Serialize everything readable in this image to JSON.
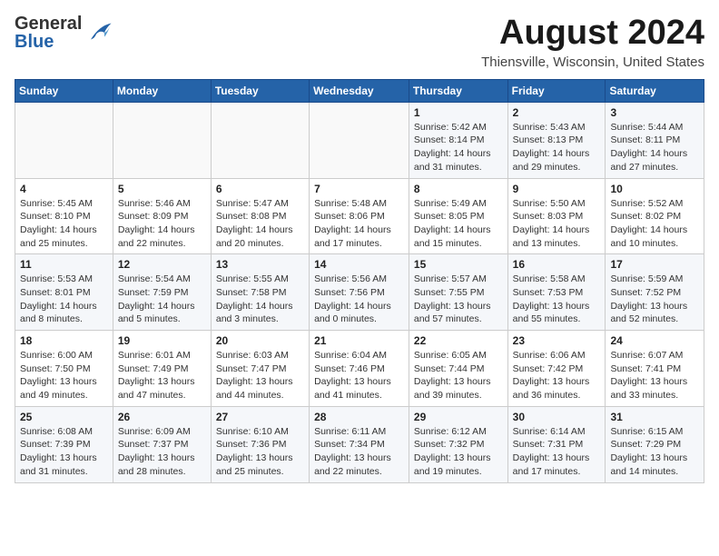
{
  "header": {
    "logo": {
      "line1": "General",
      "line2": "Blue"
    },
    "month_title": "August 2024",
    "location": "Thiensville, Wisconsin, United States"
  },
  "calendar": {
    "headers": [
      "Sunday",
      "Monday",
      "Tuesday",
      "Wednesday",
      "Thursday",
      "Friday",
      "Saturday"
    ],
    "weeks": [
      [
        {
          "day": "",
          "info": ""
        },
        {
          "day": "",
          "info": ""
        },
        {
          "day": "",
          "info": ""
        },
        {
          "day": "",
          "info": ""
        },
        {
          "day": "1",
          "info": "Sunrise: 5:42 AM\nSunset: 8:14 PM\nDaylight: 14 hours\nand 31 minutes."
        },
        {
          "day": "2",
          "info": "Sunrise: 5:43 AM\nSunset: 8:13 PM\nDaylight: 14 hours\nand 29 minutes."
        },
        {
          "day": "3",
          "info": "Sunrise: 5:44 AM\nSunset: 8:11 PM\nDaylight: 14 hours\nand 27 minutes."
        }
      ],
      [
        {
          "day": "4",
          "info": "Sunrise: 5:45 AM\nSunset: 8:10 PM\nDaylight: 14 hours\nand 25 minutes."
        },
        {
          "day": "5",
          "info": "Sunrise: 5:46 AM\nSunset: 8:09 PM\nDaylight: 14 hours\nand 22 minutes."
        },
        {
          "day": "6",
          "info": "Sunrise: 5:47 AM\nSunset: 8:08 PM\nDaylight: 14 hours\nand 20 minutes."
        },
        {
          "day": "7",
          "info": "Sunrise: 5:48 AM\nSunset: 8:06 PM\nDaylight: 14 hours\nand 17 minutes."
        },
        {
          "day": "8",
          "info": "Sunrise: 5:49 AM\nSunset: 8:05 PM\nDaylight: 14 hours\nand 15 minutes."
        },
        {
          "day": "9",
          "info": "Sunrise: 5:50 AM\nSunset: 8:03 PM\nDaylight: 14 hours\nand 13 minutes."
        },
        {
          "day": "10",
          "info": "Sunrise: 5:52 AM\nSunset: 8:02 PM\nDaylight: 14 hours\nand 10 minutes."
        }
      ],
      [
        {
          "day": "11",
          "info": "Sunrise: 5:53 AM\nSunset: 8:01 PM\nDaylight: 14 hours\nand 8 minutes."
        },
        {
          "day": "12",
          "info": "Sunrise: 5:54 AM\nSunset: 7:59 PM\nDaylight: 14 hours\nand 5 minutes."
        },
        {
          "day": "13",
          "info": "Sunrise: 5:55 AM\nSunset: 7:58 PM\nDaylight: 14 hours\nand 3 minutes."
        },
        {
          "day": "14",
          "info": "Sunrise: 5:56 AM\nSunset: 7:56 PM\nDaylight: 14 hours\nand 0 minutes."
        },
        {
          "day": "15",
          "info": "Sunrise: 5:57 AM\nSunset: 7:55 PM\nDaylight: 13 hours\nand 57 minutes."
        },
        {
          "day": "16",
          "info": "Sunrise: 5:58 AM\nSunset: 7:53 PM\nDaylight: 13 hours\nand 55 minutes."
        },
        {
          "day": "17",
          "info": "Sunrise: 5:59 AM\nSunset: 7:52 PM\nDaylight: 13 hours\nand 52 minutes."
        }
      ],
      [
        {
          "day": "18",
          "info": "Sunrise: 6:00 AM\nSunset: 7:50 PM\nDaylight: 13 hours\nand 49 minutes."
        },
        {
          "day": "19",
          "info": "Sunrise: 6:01 AM\nSunset: 7:49 PM\nDaylight: 13 hours\nand 47 minutes."
        },
        {
          "day": "20",
          "info": "Sunrise: 6:03 AM\nSunset: 7:47 PM\nDaylight: 13 hours\nand 44 minutes."
        },
        {
          "day": "21",
          "info": "Sunrise: 6:04 AM\nSunset: 7:46 PM\nDaylight: 13 hours\nand 41 minutes."
        },
        {
          "day": "22",
          "info": "Sunrise: 6:05 AM\nSunset: 7:44 PM\nDaylight: 13 hours\nand 39 minutes."
        },
        {
          "day": "23",
          "info": "Sunrise: 6:06 AM\nSunset: 7:42 PM\nDaylight: 13 hours\nand 36 minutes."
        },
        {
          "day": "24",
          "info": "Sunrise: 6:07 AM\nSunset: 7:41 PM\nDaylight: 13 hours\nand 33 minutes."
        }
      ],
      [
        {
          "day": "25",
          "info": "Sunrise: 6:08 AM\nSunset: 7:39 PM\nDaylight: 13 hours\nand 31 minutes."
        },
        {
          "day": "26",
          "info": "Sunrise: 6:09 AM\nSunset: 7:37 PM\nDaylight: 13 hours\nand 28 minutes."
        },
        {
          "day": "27",
          "info": "Sunrise: 6:10 AM\nSunset: 7:36 PM\nDaylight: 13 hours\nand 25 minutes."
        },
        {
          "day": "28",
          "info": "Sunrise: 6:11 AM\nSunset: 7:34 PM\nDaylight: 13 hours\nand 22 minutes."
        },
        {
          "day": "29",
          "info": "Sunrise: 6:12 AM\nSunset: 7:32 PM\nDaylight: 13 hours\nand 19 minutes."
        },
        {
          "day": "30",
          "info": "Sunrise: 6:14 AM\nSunset: 7:31 PM\nDaylight: 13 hours\nand 17 minutes."
        },
        {
          "day": "31",
          "info": "Sunrise: 6:15 AM\nSunset: 7:29 PM\nDaylight: 13 hours\nand 14 minutes."
        }
      ]
    ]
  }
}
